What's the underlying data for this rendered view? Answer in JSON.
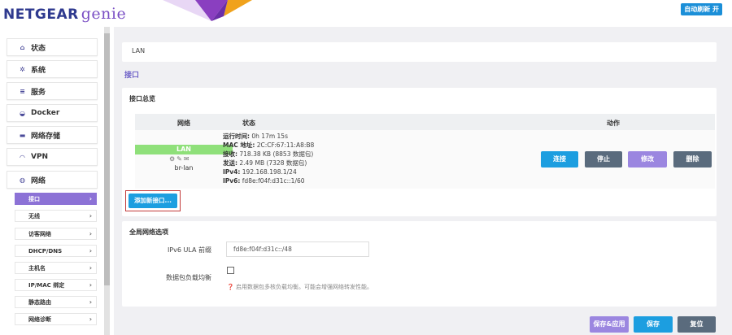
{
  "header": {
    "brand": "NETGEAR",
    "brand_suffix": "genie",
    "refresh_label": "自动刷新 开"
  },
  "sidebar": {
    "items": [
      {
        "label": "状态",
        "icon": "home-icon"
      },
      {
        "label": "系统",
        "icon": "gear-icon"
      },
      {
        "label": "服务",
        "icon": "list-icon"
      },
      {
        "label": "Docker",
        "icon": "docker-icon"
      },
      {
        "label": "网络存储",
        "icon": "storage-icon"
      },
      {
        "label": "VPN",
        "icon": "vpn-icon"
      },
      {
        "label": "网络",
        "icon": "globe-icon"
      }
    ],
    "subitems": [
      {
        "label": "接口",
        "active": true
      },
      {
        "label": "无线"
      },
      {
        "label": "访客网络"
      },
      {
        "label": "DHCP/DNS"
      },
      {
        "label": "主机名"
      },
      {
        "label": "IP/MAC 绑定"
      },
      {
        "label": "静态路由"
      },
      {
        "label": "网络诊断"
      }
    ]
  },
  "breadcrumb": "LAN",
  "page_title": "接口",
  "overview": {
    "title": "接口总览",
    "col_network": "网络",
    "col_status": "状态",
    "col_actions": "动作",
    "interface": {
      "name": "LAN",
      "device": "br-lan",
      "status": [
        {
          "label": "运行时间:",
          "value": " 0h 17m 15s"
        },
        {
          "label": "MAC 地址:",
          "value": " 2C:CF:67:11:A8:B8"
        },
        {
          "label": "接收:",
          "value": " 718.38 KB (8853 数据包)"
        },
        {
          "label": "发送:",
          "value": " 2.49 MB (7328 数据包)"
        },
        {
          "label": "IPv4:",
          "value": " 192.168.198.1/24"
        },
        {
          "label": "IPv6:",
          "value": " fd8e:f04f:d31c::1/60"
        }
      ]
    },
    "actions": {
      "connect": "连接",
      "stop": "停止",
      "edit": "修改",
      "delete": "删除"
    },
    "add_button": "添加新接口..."
  },
  "global": {
    "title": "全局网络选项",
    "ula_label": "IPv6 ULA 前缀",
    "ula_value": "fd8e:f04f:d31c::/48",
    "balance_label": "数据包负载均衡",
    "balance_help": "❓ 启用数据包多核负载均衡。可能会增强网络转发性能。"
  },
  "footer": {
    "save_apply": "保存&应用",
    "save": "保存",
    "reset": "复位"
  },
  "colors": {
    "accent": "#8c72d6",
    "primary_button": "#1c9ee0",
    "neutral_button": "#5a6b7d",
    "lan_badge": "#8fe07a"
  }
}
